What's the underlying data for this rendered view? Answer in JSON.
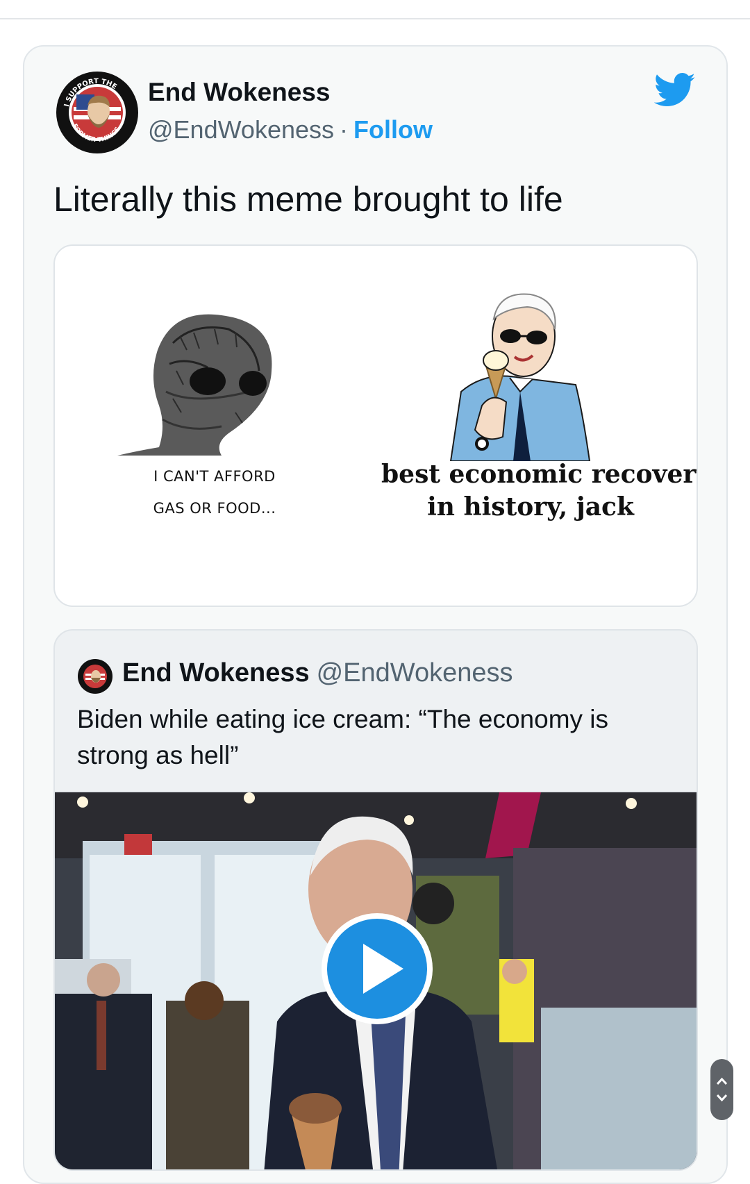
{
  "tweet": {
    "author_name": "End Wokeness",
    "handle": "@EndWokeness",
    "separator": "·",
    "follow_label": "Follow",
    "text": "Literally this meme brought to life",
    "avatar_text_top": "I SUPPORT THE",
    "avatar_text_bottom": "FORMER THINGS"
  },
  "meme": {
    "left_caption_line1": "I CAN'T AFFORD",
    "left_caption_line2": "GAS OR FOOD...",
    "right_caption_line1": "best economic recovery",
    "right_caption_line2": "in history, jack"
  },
  "quoted": {
    "author_name": "End Wokeness",
    "handle": "@EndWokeness",
    "text": "Biden while eating ice cream: “The economy is strong as hell”"
  },
  "icons": {
    "brand": "twitter-bird-icon",
    "video": "play-icon",
    "scroll": "scroll-chevrons-icon"
  },
  "colors": {
    "twitter_blue": "#1d9bf0",
    "card_bg": "#f7f9f9",
    "quote_bg": "#eef1f3",
    "muted_text": "#536471"
  }
}
